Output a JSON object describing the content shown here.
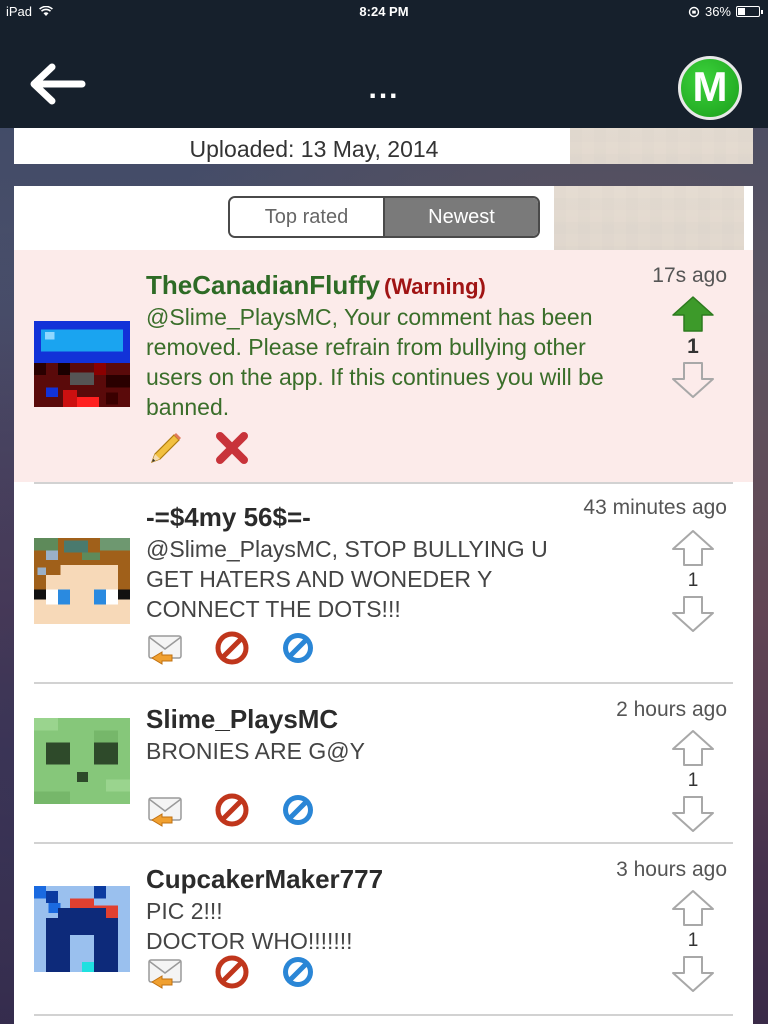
{
  "status_bar": {
    "device": "iPad",
    "time": "8:24 PM",
    "battery": "36%",
    "battery_level": 0.36
  },
  "navbar": {
    "title": "...",
    "logo_letter": "M"
  },
  "upload": {
    "text": "Uploaded: 13 May, 2014"
  },
  "tabs": [
    {
      "label": "Top rated",
      "selected": false
    },
    {
      "label": "Newest",
      "selected": true
    }
  ],
  "comments": [
    {
      "username": "TheCanadianFluffy",
      "tag": "(Warning)",
      "text": "@Slime_PlaysMC, Your comment has been removed. Please refrain from bullying other users on the app. If this continues you will be banned.",
      "time": "17s ago",
      "votes": "1",
      "upvoted": true,
      "highlight": true,
      "actions": [
        "edit-pencil-icon",
        "delete-x-icon"
      ]
    },
    {
      "username": "-=$4my 56$=-",
      "text": "@Slime_PlaysMC, STOP BULLYING U GET HATERS AND WONEDER Y CONNECT THE DOTS!!!",
      "time": "43 minutes ago",
      "votes": "1",
      "actions": [
        "reply-envelope-icon",
        "block-icon",
        "report-icon"
      ]
    },
    {
      "username": "Slime_PlaysMC",
      "text": "BRONIES ARE G@Y",
      "time": "2 hours ago",
      "votes": "1",
      "actions": [
        "reply-envelope-icon",
        "block-icon",
        "report-icon"
      ]
    },
    {
      "username": "CupcakerMaker777",
      "text_lines": [
        "PIC 2!!!",
        "DOCTOR WHO!!!!!!!"
      ],
      "time": "3 hours ago",
      "votes": "1",
      "actions": [
        "reply-envelope-icon",
        "block-icon",
        "report-icon"
      ]
    }
  ],
  "colors": {
    "nav_bg": "#16202c",
    "logo_green": "#1a9e1a",
    "upvote_green": "#3d9a2a",
    "warning_bg": "#fcebea",
    "warning_red": "#a01414",
    "username_green": "#2e6b26"
  }
}
